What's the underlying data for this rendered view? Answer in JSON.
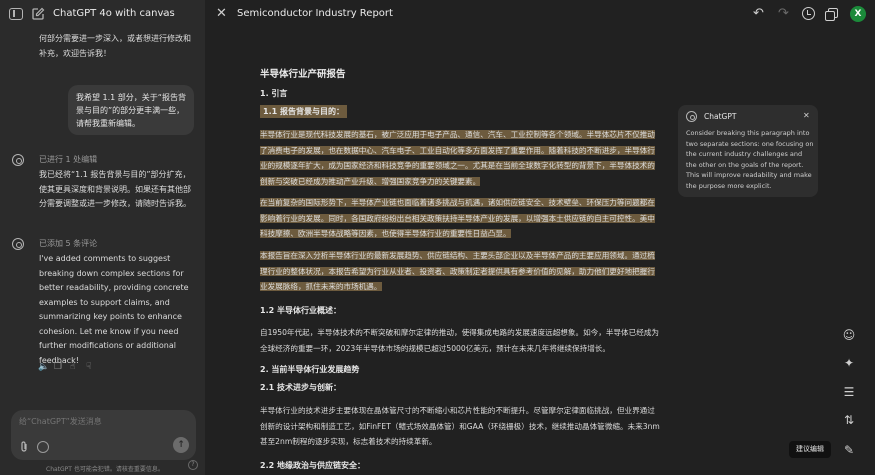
{
  "app": {
    "model_title": "ChatGPT 4o with canvas"
  },
  "chat": {
    "msg_top": "何部分需要进一步深入，或者想进行修改和补充，欢迎告诉我！",
    "user_message": "我希望 1.1 部分，关于“报告背景与目的”的部分更丰满一些，请帮我重新编辑。",
    "status_1": "已进行 1 处编辑",
    "msg_2": "我已经将“1.1 报告背景与目的”部分扩充，使其更具深度和背景说明。如果还有其他部分需要调整或进一步修改，请随时告诉我。",
    "status_2": "已添加 5 条评论",
    "msg_3": "I've added comments to suggest breaking down complex sections for better readability, providing concrete examples to support claims, and summarizing key points to enhance cohesion. Let me know if you need further modifications or additional feedback!"
  },
  "composer": {
    "placeholder": "给“ChatGPT”发送消息",
    "disclaimer": "ChatGPT 也可能会犯错。请核查重要信息。",
    "help": "?"
  },
  "canvas": {
    "title": "Semiconductor Industry Report",
    "user_initial": "X"
  },
  "doc": {
    "h_title": "半导体行业产研报告",
    "h_intro": "1. 引言",
    "h_1_1": "1.1 报告背景与目的：",
    "p1": "半导体行业是现代科技发展的基石，被广泛应用于电子产品、通信、汽车、工业控制等各个领域。半导体芯片不仅推动了消费电子的发展，也在数据中心、汽车电子、工业自动化等多方面发挥了重要作用。随着科技的不断进步，半导体行业的规模逐年扩大，成为国家经济和科技竞争的重要领域之一。尤其是在当前全球数字化转型的背景下，半导体技术的创新与突破已经成为推动产业升级、增强国家竞争力的关键要素。",
    "p2": "在当前复杂的国际形势下，半导体产业链也面临着诸多挑战与机遇，诸如供应链安全、技术壁垒、环保压力等问题都在影响着行业的发展。同时，各国政府纷纷出台相关政策扶持半导体产业的发展，以增强本土供应链的自主可控性。美中科技摩擦、欧洲半导体战略等因素，也使得半导体行业的重要性日益凸显。",
    "p3": "本报告旨在深入分析半导体行业的最新发展趋势、供应链结构、主要头部企业以及半导体产品的主要应用领域。通过梳理行业的整体状况，本报告希望为行业从业者、投资者、政策制定者提供具有参考价值的见解，助力他们更好地把握行业发展脉络，抓住未来的市场机遇。",
    "h_1_2": "1.2 半导体行业概述：",
    "p4": "自1950年代起，半导体技术的不断突破和摩尔定律的推动，使得集成电路的发展速度远超想象。如今，半导体已经成为全球经济的重要一环，2023年半导体市场的规模已超过5000亿美元，预计在未来几年将继续保持增长。",
    "h_2": "2. 当前半导体行业发展趋势",
    "h_2_1": "2.1 技术进步与创新：",
    "p5": "半导体行业的技术进步主要体现在晶体管尺寸的不断缩小和芯片性能的不断提升。尽管摩尔定律面临挑战，但业界通过创新的设计架构和制造工艺，如FinFET（鳍式场效晶体管）和GAA（环绕栅极）技术，继续推动晶体管微缩。未来3nm甚至2nm制程的逐步实现，标志着技术的持续革新。",
    "h_2_2": "2.2 地缘政治与供应链安全："
  },
  "comment": {
    "author": "ChatGPT",
    "text": "Consider breaking this paragraph into two separate sections: one focusing on the current industry challenges and the other on the goals of the report. This will improve readability and make the purpose more explicit."
  },
  "rail": {
    "tooltip": "建议编辑"
  },
  "icons": {
    "sidebar": "sidebar-toggle-icon",
    "new_chat": "new-chat-icon",
    "undo": "undo-icon",
    "redo": "redo-icon",
    "history": "history-icon",
    "copy": "copy-icon",
    "emoji": "emoji-icon",
    "polish": "polish-icon",
    "reading_level": "reading-level-icon",
    "length": "length-icon",
    "suggest_edits": "suggest-edits-icon"
  },
  "colors": {
    "highlight": "#6d5b3e",
    "avatar": "#1b8a3a",
    "background": "#212121",
    "sidebar": "#2b2b2b"
  }
}
